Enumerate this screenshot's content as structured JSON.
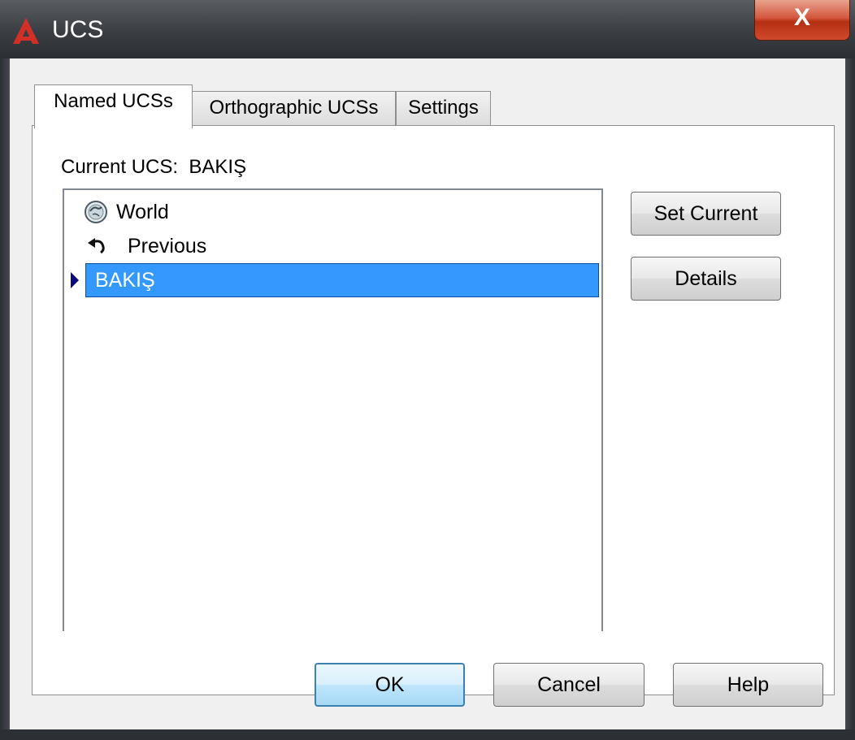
{
  "window": {
    "title": "UCS",
    "close_glyph": "X",
    "app_icon": "autocad-logo-icon",
    "close_icon": "close-icon"
  },
  "tabs": [
    {
      "label": "Named UCSs",
      "active": true
    },
    {
      "label": "Orthographic UCSs",
      "active": false
    },
    {
      "label": "Settings",
      "active": false
    }
  ],
  "current_ucs": {
    "label": "Current UCS:",
    "value": "BAKIŞ"
  },
  "ucs_list": {
    "items": [
      {
        "label": "World",
        "icon": "globe-icon",
        "selected": false
      },
      {
        "label": "Previous",
        "icon": "undo-arrow-icon",
        "selected": false
      },
      {
        "label": "BAKIŞ",
        "icon": "current-marker-icon",
        "selected": true
      }
    ]
  },
  "side_buttons": {
    "set_current": "Set Current",
    "details": "Details"
  },
  "footer_buttons": {
    "ok": "OK",
    "cancel": "Cancel",
    "help": "Help"
  },
  "colors": {
    "selection": "#3399ff",
    "accent_red": "#d22f27",
    "titlebar": "#3a3d42",
    "close_button": "#c8452a"
  }
}
